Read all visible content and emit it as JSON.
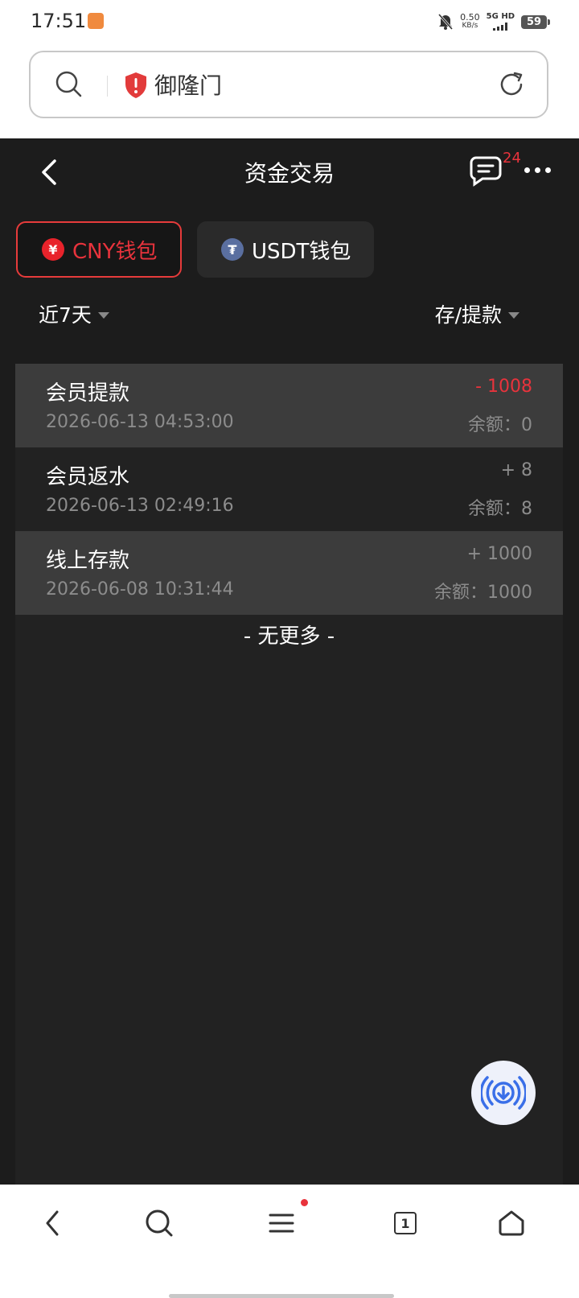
{
  "status_bar": {
    "time": "17:51",
    "net_speed_value": "0.50",
    "net_speed_unit": "KB/s",
    "network_label": "5G HD",
    "battery": "59"
  },
  "browser": {
    "site_name": "御隆门"
  },
  "header": {
    "title": "资金交易",
    "badge_count": "24"
  },
  "wallet_tabs": [
    {
      "label": "CNY钱包",
      "coin_symbol": "¥",
      "active": true
    },
    {
      "label": "USDT钱包",
      "coin_symbol": "₮",
      "active": false
    }
  ],
  "filters": {
    "date_range": "近7天",
    "type": "存/提款"
  },
  "transactions": [
    {
      "title": "会员提款",
      "time": "2026-06-13 04:53:00",
      "amount": "- 1008",
      "balance": "余额：0",
      "amount_color": "#e8333c"
    },
    {
      "title": "会员返水",
      "time": "2026-06-13 02:49:16",
      "amount": "+ 8",
      "balance": "余额：8",
      "amount_color": "#8c8c8c"
    },
    {
      "title": "线上存款",
      "time": "2026-06-08 10:31:44",
      "amount": "+ 1000",
      "balance": "余额：1000",
      "amount_color": "#8c8c8c"
    }
  ],
  "list_footer": "- 无更多 -",
  "bottom_nav": {
    "tab_count": "1"
  },
  "colors": {
    "accent_red": "#e8333c",
    "app_background": "#1c1c1c",
    "list_background": "#222222"
  },
  "icons": [
    "search-icon",
    "shield-alert-icon",
    "reload-icon",
    "back-arrow-icon",
    "message-icon",
    "more-icon",
    "cny-coin-icon",
    "usdt-coin-icon",
    "caret-down-icon",
    "download-icon",
    "home-icon",
    "menu-icon",
    "tabs-icon"
  ]
}
